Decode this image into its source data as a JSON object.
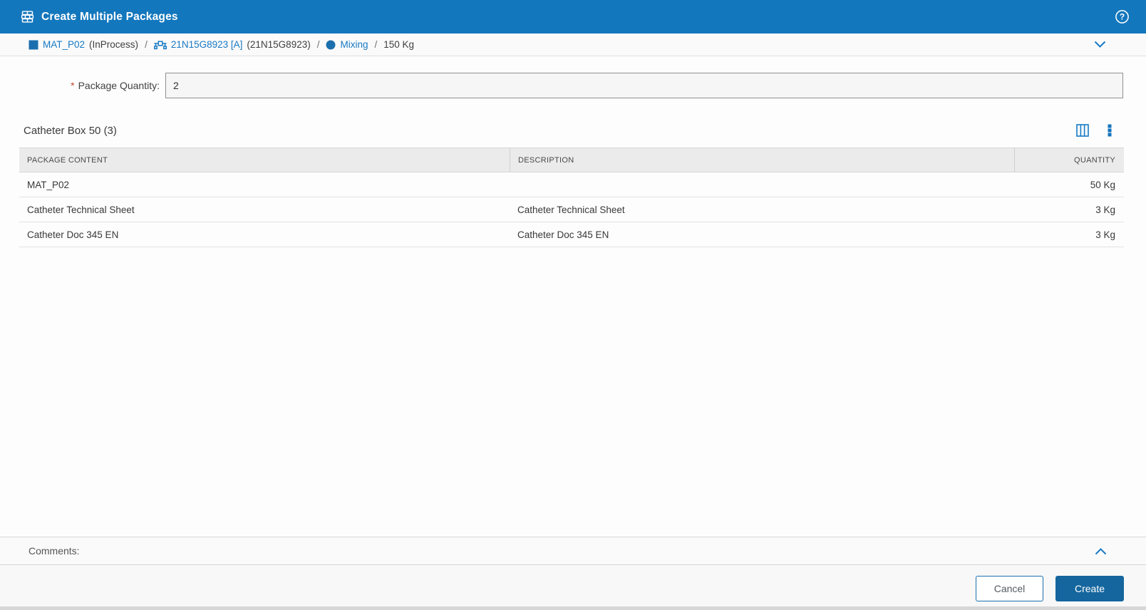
{
  "titlebar": {
    "title": "Create Multiple Packages",
    "help_glyph": "?"
  },
  "breadcrumb": {
    "separator": "/",
    "items": [
      {
        "icon": "material-square-icon",
        "label": "MAT_P02",
        "status": "(InProcess)"
      },
      {
        "icon": "sublot-icon",
        "label": "21N15G8923 [A]",
        "status": "(21N15G8923)"
      },
      {
        "icon": "step-circle-icon",
        "label": "Mixing"
      },
      {
        "label": "150 Kg"
      }
    ]
  },
  "form": {
    "required_marker": "*",
    "package_quantity_label": "Package Quantity:",
    "package_quantity_value": "2"
  },
  "table": {
    "title": "Catheter Box 50 (3)",
    "columns": [
      "PACKAGE CONTENT",
      "DESCRIPTION",
      "QUANTITY"
    ],
    "rows": [
      {
        "package_content": "MAT_P02",
        "description": "",
        "quantity": "50 Kg"
      },
      {
        "package_content": "Catheter Technical Sheet",
        "description": "Catheter Technical Sheet",
        "quantity": "3 Kg"
      },
      {
        "package_content": "Catheter Doc 345 EN",
        "description": "Catheter Doc 345 EN",
        "quantity": "3 Kg"
      }
    ]
  },
  "comments": {
    "label": "Comments:"
  },
  "footer": {
    "cancel_label": "Cancel",
    "create_label": "Create"
  },
  "colors": {
    "header_blue": "#1377bd",
    "link_blue": "#1779c4",
    "create_button_blue": "#15669e",
    "required_asterisk": "#bf4b32",
    "table_header_bg": "#ebebeb"
  }
}
